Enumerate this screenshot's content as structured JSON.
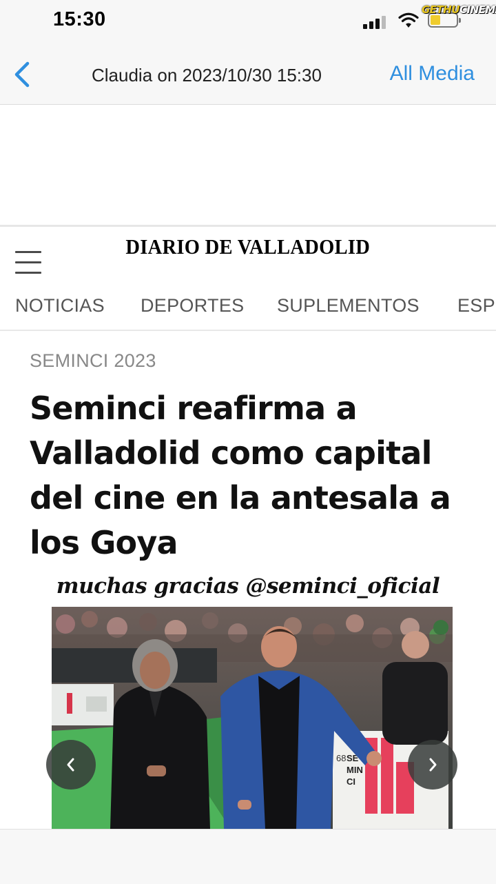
{
  "status_bar": {
    "time": "15:30",
    "watermark_left": "GETHU",
    "watermark_right": "CINEMA",
    "battery_color": "#f0cc2d"
  },
  "nav": {
    "back_icon": "chevron-left-icon",
    "title": "Claudia on 2023/10/30 15:30",
    "all_media_label": "All Media",
    "accent_color": "#2f8fdf"
  },
  "site": {
    "masthead": "DIARIO DE VALLADOLID",
    "menu_icon": "hamburger-menu-icon",
    "sections": [
      "NOTICIAS",
      "DEPORTES",
      "SUPLEMENTOS",
      "ESPE"
    ]
  },
  "article": {
    "kicker": "SEMINCI 2023",
    "headline_lines": [
      "Seminci reafirma a",
      "Valladolid como capital",
      "del cine en la antesala a",
      "los Goya"
    ],
    "overlay_caption": "muchas gracias @seminci_oficial"
  },
  "photo": {
    "sign_text": [
      "68",
      "SE",
      "MIN",
      "CI"
    ],
    "prev_icon": "chevron-left-icon",
    "next_icon": "chevron-right-icon"
  }
}
